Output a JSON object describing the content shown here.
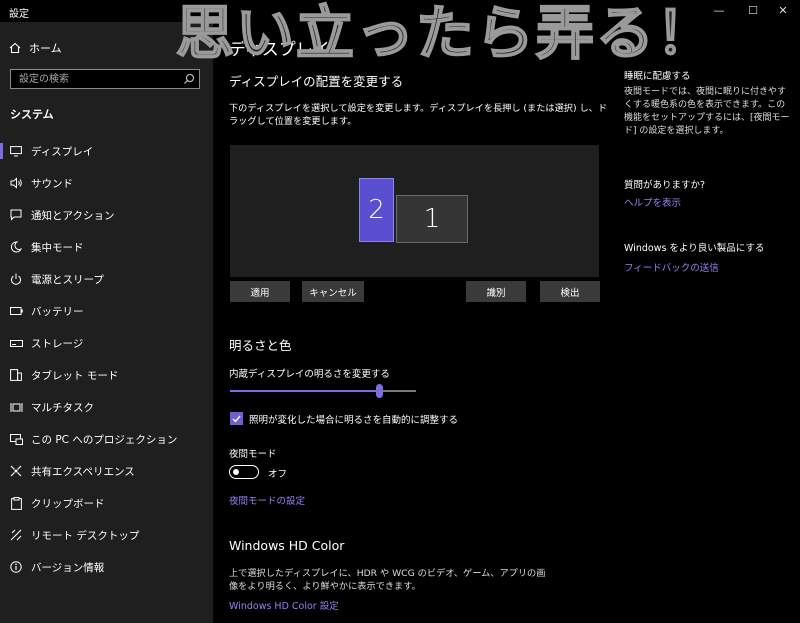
{
  "window": {
    "title": "設定"
  },
  "banner": {
    "text": "思い立ったら弄る！"
  },
  "sidebar": {
    "home_label": "ホーム",
    "search_placeholder": "設定の検索",
    "section": "システム",
    "items": [
      {
        "label": "ディスプレイ",
        "icon": "monitor-icon",
        "active": true
      },
      {
        "label": "サウンド",
        "icon": "speaker-icon"
      },
      {
        "label": "通知とアクション",
        "icon": "notification-icon"
      },
      {
        "label": "集中モード",
        "icon": "moon-icon"
      },
      {
        "label": "電源とスリープ",
        "icon": "power-icon"
      },
      {
        "label": "バッテリー",
        "icon": "battery-icon"
      },
      {
        "label": "ストレージ",
        "icon": "storage-icon"
      },
      {
        "label": "タブレット モード",
        "icon": "tablet-icon"
      },
      {
        "label": "マルチタスク",
        "icon": "multitask-icon"
      },
      {
        "label": "この PC へのプロジェクション",
        "icon": "projection-icon"
      },
      {
        "label": "共有エクスペリエンス",
        "icon": "share-icon"
      },
      {
        "label": "クリップボード",
        "icon": "clipboard-icon"
      },
      {
        "label": "リモート デスクトップ",
        "icon": "remote-icon"
      },
      {
        "label": "バージョン情報",
        "icon": "info-icon"
      }
    ]
  },
  "main": {
    "title": "ディスプレイ",
    "arrange_heading": "ディスプレイの配置を変更する",
    "arrange_desc": "下のディスプレイを選択して設定を変更します。ディスプレイを長押し (または選択) し、ドラッグして位置を変更します。",
    "monitors": {
      "primary": "1",
      "secondary": "2"
    },
    "buttons": {
      "apply": "適用",
      "cancel": "キャンセル",
      "identify": "識別",
      "detect": "検出"
    },
    "brightness_heading": "明るさと色",
    "brightness_label": "内蔵ディスプレイの明るさを変更する",
    "brightness_value": 0.8,
    "auto_brightness_label": "照明が変化した場合に明るさを自動的に調整する",
    "auto_brightness_checked": true,
    "night_mode_label": "夜間モード",
    "night_mode_state": "オフ",
    "night_mode_settings_link": "夜間モードの設定",
    "hd_heading": "Windows HD Color",
    "hd_desc": "上で選択したディスプレイに、HDR や WCG のビデオ、ゲーム、アプリの画像をより明るく、より鮮やかに表示できます。",
    "hd_link": "Windows HD Color 設定"
  },
  "right": {
    "sleep_title": "睡眠に配慮する",
    "sleep_desc": "夜間モードでは、夜間に眠りに付きやすくする暖色系の色を表示できます。この機能をセットアップするには、[夜間モード] の設定を選択します。",
    "question_title": "質問がありますか?",
    "help_link": "ヘルプを表示",
    "improve_title": "Windows をより良い製品にする",
    "feedback_link": "フィードバックの送信"
  },
  "colors": {
    "accent": "#7b6fe0",
    "link": "#8f86f0",
    "sidebar_bg": "#1f1f1f"
  }
}
